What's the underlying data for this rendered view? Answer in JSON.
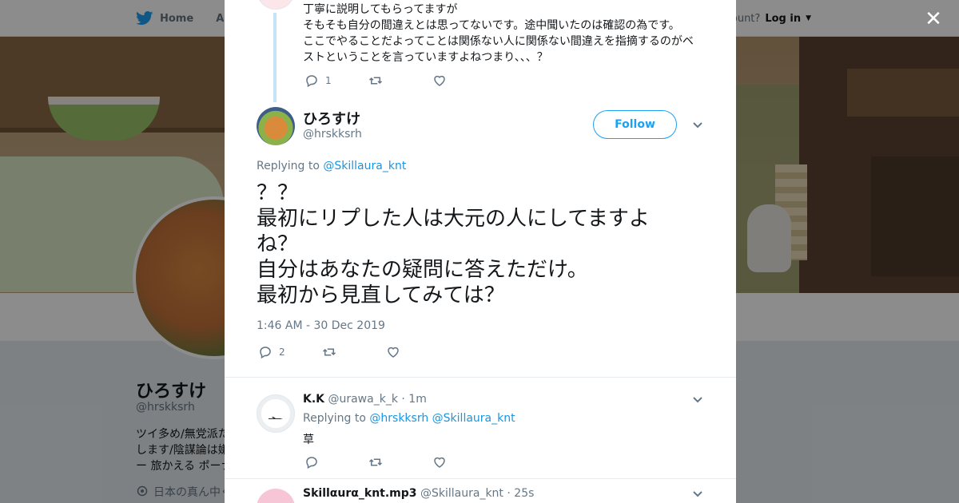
{
  "nav": {
    "home_label": "Home",
    "about_label": "Abo",
    "account_prompt": "ccount?",
    "login_label": "Log in"
  },
  "profile": {
    "name": "ひろすけ",
    "handle": "@hrskksrh",
    "bio_lines": [
      "ツイ多め/無党派た",
      "します/陰謀論は嫌",
      "ー 旅かえる ポーナ"
    ],
    "location": "日本の真ん中く"
  },
  "previous_tweet": {
    "lines": [
      "丁寧に説明してもらってますが",
      "そもそも自分の間違えとは思ってないです。途中聞いたのは確認の為です。",
      "ここでやることだよってことは関係ない人に関係ない間違えを指摘するのがベ",
      "ストということを言っていますよねつまり、、、？"
    ],
    "reply_count": "1"
  },
  "main_tweet": {
    "name": "ひろすけ",
    "handle": "@hrskksrh",
    "follow_label": "Follow",
    "replying_prefix": "Replying to",
    "replying_to": "@Skillaura_knt",
    "text_lines": [
      "？？",
      "最初にリプした人は大元の人にしてますよ",
      "ね？",
      "自分はあなたの疑問に答えただけ。",
      "最初から見直してみては？"
    ],
    "timestamp": "1:46 AM - 30 Dec 2019",
    "reply_count": "2"
  },
  "replies": [
    {
      "name": "K.K",
      "handle": "@urawa_k_k",
      "sep": "·",
      "time": "1m",
      "replying_prefix": "Replying to",
      "replying_to_1": "@hrskksrh",
      "replying_to_2": "@Skillaura_knt",
      "text": "草"
    },
    {
      "name": "Skillαurα_knt.mp3",
      "handle": "@Skillaura_knt",
      "sep": "·",
      "time": "25s"
    }
  ],
  "colors": {
    "accent": "#1da1f2",
    "link": "#1b95e0",
    "muted": "#657786",
    "thread_line": "#c4e4f7"
  }
}
